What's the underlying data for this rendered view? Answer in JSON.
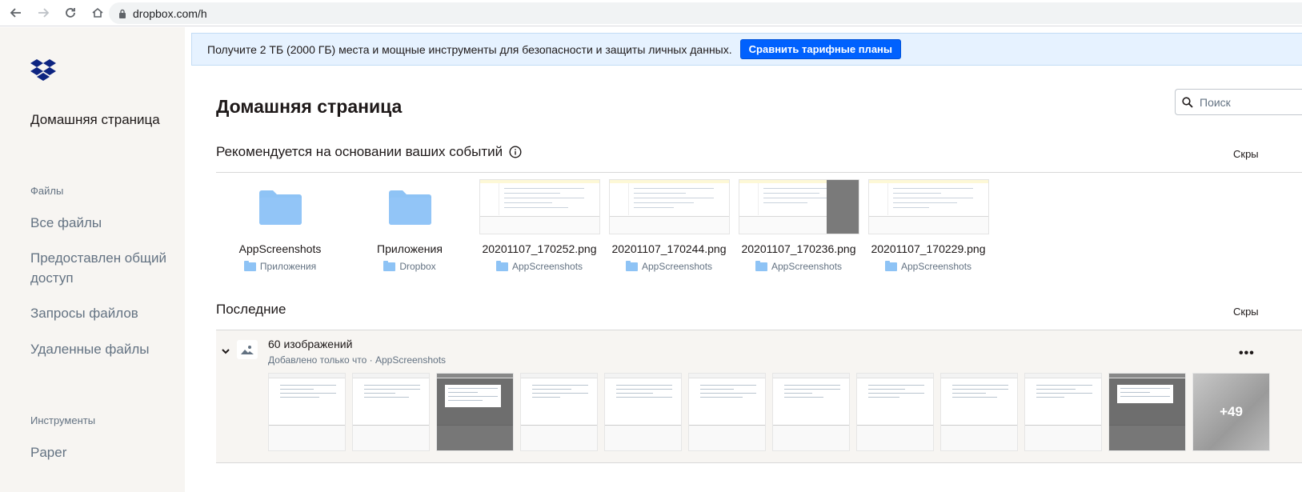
{
  "browser": {
    "url": "dropbox.com/h"
  },
  "sidebar": {
    "home_label": "Домашняя страница",
    "files_section": "Файлы",
    "items": [
      {
        "label": "Все файлы"
      },
      {
        "label": "Предоставлен общий доступ"
      },
      {
        "label": "Запросы файлов"
      },
      {
        "label": "Удаленные файлы"
      }
    ],
    "tools_section": "Инструменты",
    "tools": [
      {
        "label": "Paper"
      }
    ]
  },
  "banner": {
    "text": "Получите 2 ТБ (2000 ГБ) места и мощные инструменты для безопасности и защиты личных данных.",
    "button": "Сравнить тарифные планы"
  },
  "main": {
    "title": "Домашняя страница",
    "search_placeholder": "Поиск",
    "recommended": {
      "heading": "Рекомендуется на основании ваших событий",
      "hide": "Скры",
      "items": [
        {
          "name": "AppScreenshots",
          "location": "Приложения",
          "kind": "folder"
        },
        {
          "name": "Приложения",
          "location": "Dropbox",
          "kind": "folder"
        },
        {
          "name": "20201107_170252.png",
          "location": "AppScreenshots",
          "kind": "image"
        },
        {
          "name": "20201107_170244.png",
          "location": "AppScreenshots",
          "kind": "image"
        },
        {
          "name": "20201107_170236.png",
          "location": "AppScreenshots",
          "kind": "image"
        },
        {
          "name": "20201107_170229.png",
          "location": "AppScreenshots",
          "kind": "image"
        }
      ]
    },
    "recent": {
      "heading": "Последние",
      "hide": "Скры",
      "group_title": "60 изображений",
      "group_subtitle": "Добавлено только что · AppScreenshots",
      "more_label": "•••",
      "extra_count": "+49"
    }
  },
  "colors": {
    "accent": "#0061fe",
    "sidebar_bg": "#f7f5f2",
    "banner_bg": "#e6f2ff",
    "folder": "#8ec3f5"
  }
}
